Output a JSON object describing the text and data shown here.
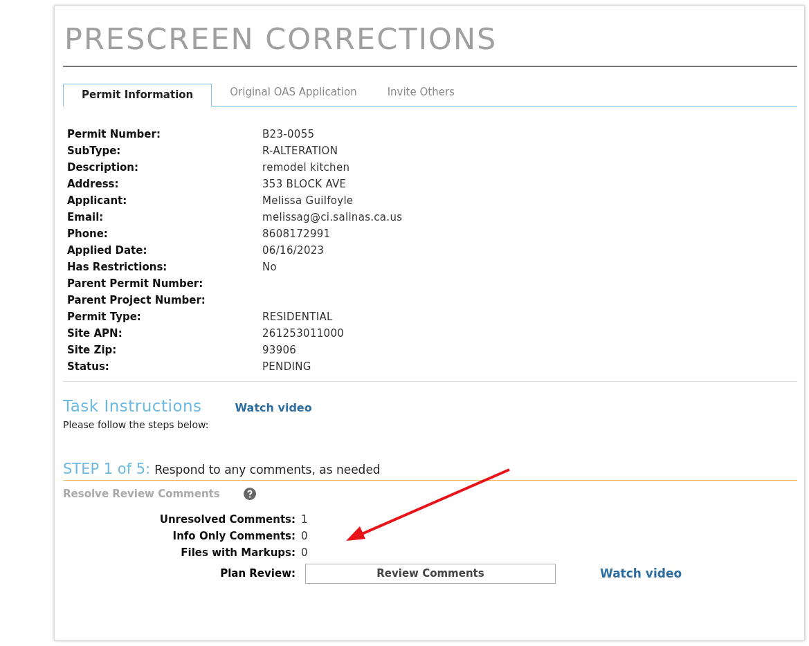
{
  "title": "PRESCREEN CORRECTIONS",
  "tabs": [
    {
      "label": "Permit Information",
      "selected": true
    },
    {
      "label": "Original OAS Application",
      "selected": false
    },
    {
      "label": "Invite Others",
      "selected": false
    }
  ],
  "permit_fields": [
    {
      "label": "Permit Number:",
      "value": "B23-0055"
    },
    {
      "label": "SubType:",
      "value": "R-ALTERATION"
    },
    {
      "label": "Description:",
      "value": "remodel kitchen"
    },
    {
      "label": "Address:",
      "value": "353 BLOCK AVE"
    },
    {
      "label": "Applicant:",
      "value": "Melissa Guilfoyle"
    },
    {
      "label": "Email:",
      "value": "melissag@ci.salinas.ca.us"
    },
    {
      "label": "Phone:",
      "value": "8608172991"
    },
    {
      "label": "Applied Date:",
      "value": "06/16/2023"
    },
    {
      "label": "Has Restrictions:",
      "value": "No"
    },
    {
      "label": "Parent Permit Number:"
    },
    {
      "label": "Parent Project Number:"
    },
    {
      "label": "Permit Type:",
      "value": "RESIDENTIAL"
    },
    {
      "label": "Site APN:",
      "value": "261253011000"
    },
    {
      "label": "Site Zip:",
      "value": "93906"
    },
    {
      "label": "Status:",
      "value": "PENDING"
    }
  ],
  "task_instructions": {
    "heading": "Task Instructions",
    "video_link": "Watch video",
    "intro": "Please follow the steps below:"
  },
  "step": {
    "number": "STEP 1 of 5:",
    "text": "Respond to any comments, as needed"
  },
  "resolve": {
    "heading": "Resolve Review Comments",
    "counts": [
      {
        "label": "Unresolved Comments:",
        "value": "1"
      },
      {
        "label": "Info Only Comments:",
        "value": "0"
      },
      {
        "label": "Files with Markups:",
        "value": "0"
      }
    ],
    "plan_review": {
      "label": "Plan Review:",
      "button": "Review Comments",
      "video_link": "Watch video"
    }
  },
  "annotation": {
    "kind": "arrow"
  }
}
